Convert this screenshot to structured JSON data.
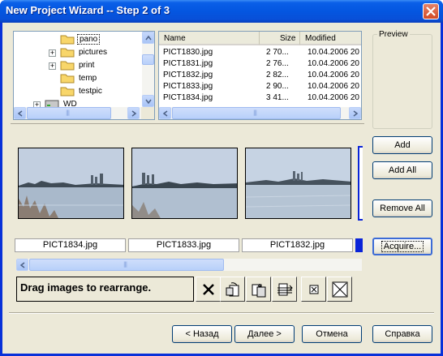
{
  "window": {
    "title": "New Project Wizard -- Step 2 of 3",
    "close_icon": "close-icon"
  },
  "folder_tree": {
    "items": [
      {
        "label": "pano",
        "expander": "",
        "selected": true
      },
      {
        "label": "pictures",
        "expander": "+"
      },
      {
        "label": "print",
        "expander": "+"
      },
      {
        "label": "temp",
        "expander": ""
      },
      {
        "label": "testpic",
        "expander": ""
      },
      {
        "label": "WD",
        "expander": "+",
        "icon": "drive-icon"
      }
    ]
  },
  "file_list": {
    "columns": [
      "Name",
      "Size",
      "Modified"
    ],
    "rows": [
      {
        "name": "PICT1830.jpg",
        "size": "2 70...",
        "modified": "10.04.2006 20"
      },
      {
        "name": "PICT1831.jpg",
        "size": "2 76...",
        "modified": "10.04.2006 20"
      },
      {
        "name": "PICT1832.jpg",
        "size": "2 82...",
        "modified": "10.04.2006 20"
      },
      {
        "name": "PICT1833.jpg",
        "size": "2 90...",
        "modified": "10.04.2006 20"
      },
      {
        "name": "PICT1834.jpg",
        "size": "3 41...",
        "modified": "10.04.2006 20"
      }
    ]
  },
  "preview": {
    "label": "Preview"
  },
  "side_buttons": {
    "add": "Add",
    "add_all": "Add All",
    "remove_all": "Remove All",
    "acquire": "Acquire..."
  },
  "filmstrip": {
    "captions": [
      "PICT1834.jpg",
      "PICT1833.jpg",
      "PICT1832.jpg"
    ]
  },
  "status": {
    "text": "Drag images to rearrange."
  },
  "toolbar": {
    "icons": [
      "delete-icon",
      "rotate-left-icon",
      "rotate-right-icon",
      "flip-icon",
      "fit-icon",
      "fullscreen-icon"
    ]
  },
  "footer": {
    "back": "< Назад",
    "next": "Далее >",
    "cancel": "Отмена",
    "help": "Справка"
  },
  "colors": {
    "title_bar": "#0456e0",
    "dialog_bg": "#ece9d8",
    "selection": "#0a24d8"
  }
}
